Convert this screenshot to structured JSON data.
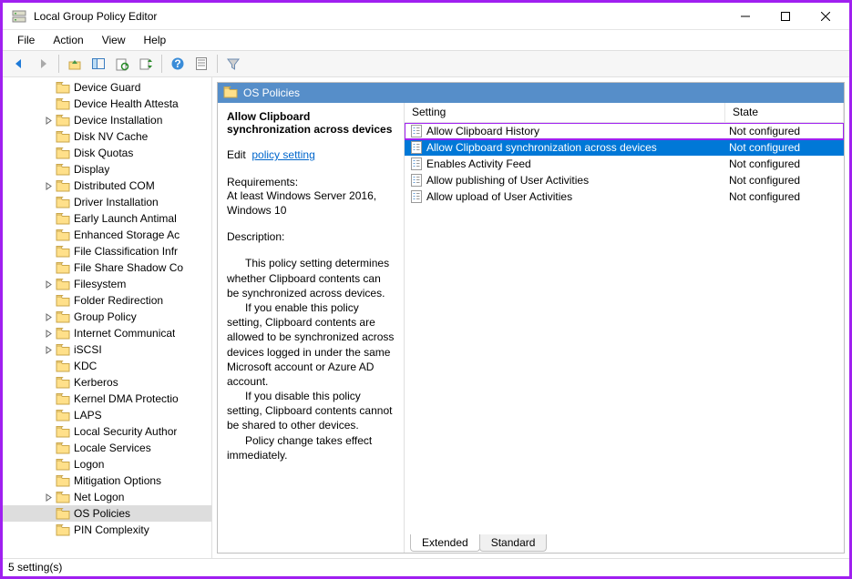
{
  "window": {
    "title": "Local Group Policy Editor"
  },
  "menu": {
    "items": [
      "File",
      "Action",
      "View",
      "Help"
    ]
  },
  "tree": {
    "items": [
      {
        "label": "Device Guard",
        "expand": false
      },
      {
        "label": "Device Health Attesta",
        "expand": false
      },
      {
        "label": "Device Installation",
        "expand": true
      },
      {
        "label": "Disk NV Cache",
        "expand": false
      },
      {
        "label": "Disk Quotas",
        "expand": false
      },
      {
        "label": "Display",
        "expand": false
      },
      {
        "label": "Distributed COM",
        "expand": true
      },
      {
        "label": "Driver Installation",
        "expand": false
      },
      {
        "label": "Early Launch Antimal",
        "expand": false
      },
      {
        "label": "Enhanced Storage Ac",
        "expand": false
      },
      {
        "label": "File Classification Infr",
        "expand": false
      },
      {
        "label": "File Share Shadow Co",
        "expand": false
      },
      {
        "label": "Filesystem",
        "expand": true
      },
      {
        "label": "Folder Redirection",
        "expand": false
      },
      {
        "label": "Group Policy",
        "expand": true
      },
      {
        "label": "Internet Communicat",
        "expand": true
      },
      {
        "label": "iSCSI",
        "expand": true
      },
      {
        "label": "KDC",
        "expand": false
      },
      {
        "label": "Kerberos",
        "expand": false
      },
      {
        "label": "Kernel DMA Protectio",
        "expand": false
      },
      {
        "label": "LAPS",
        "expand": false
      },
      {
        "label": "Local Security Author",
        "expand": false
      },
      {
        "label": "Locale Services",
        "expand": false
      },
      {
        "label": "Logon",
        "expand": false
      },
      {
        "label": "Mitigation Options",
        "expand": false
      },
      {
        "label": "Net Logon",
        "expand": true
      },
      {
        "label": "OS Policies",
        "expand": false,
        "selected": true
      },
      {
        "label": "PIN Complexity",
        "expand": false
      }
    ]
  },
  "detail": {
    "folder_title": "OS Policies",
    "setting_title": "Allow Clipboard synchronization across devices",
    "edit_label": "Edit",
    "edit_link": "policy setting",
    "requirements_label": "Requirements:",
    "requirements_text": "At least Windows Server 2016, Windows 10",
    "description_label": "Description:",
    "description_p1": "This policy setting determines whether Clipboard contents can be synchronized across devices.",
    "description_p2": "If you enable this policy setting, Clipboard contents are allowed to be synchronized across devices logged in under the same Microsoft account or Azure AD account.",
    "description_p3": "If you disable this policy setting, Clipboard contents cannot be shared to other devices.",
    "description_p4": "Policy change takes effect immediately."
  },
  "list": {
    "columns": {
      "setting": "Setting",
      "state": "State"
    },
    "rows": [
      {
        "name": "Allow Clipboard History",
        "state": "Not configured",
        "highlight": true,
        "selected": false
      },
      {
        "name": "Allow Clipboard synchronization across devices",
        "state": "Not configured",
        "highlight": false,
        "selected": true
      },
      {
        "name": "Enables Activity Feed",
        "state": "Not configured",
        "highlight": false,
        "selected": false
      },
      {
        "name": "Allow publishing of User Activities",
        "state": "Not configured",
        "highlight": false,
        "selected": false
      },
      {
        "name": "Allow upload of User Activities",
        "state": "Not configured",
        "highlight": false,
        "selected": false
      }
    ]
  },
  "tabs": {
    "extended": "Extended",
    "standard": "Standard"
  },
  "status": {
    "text": "5 setting(s)"
  }
}
